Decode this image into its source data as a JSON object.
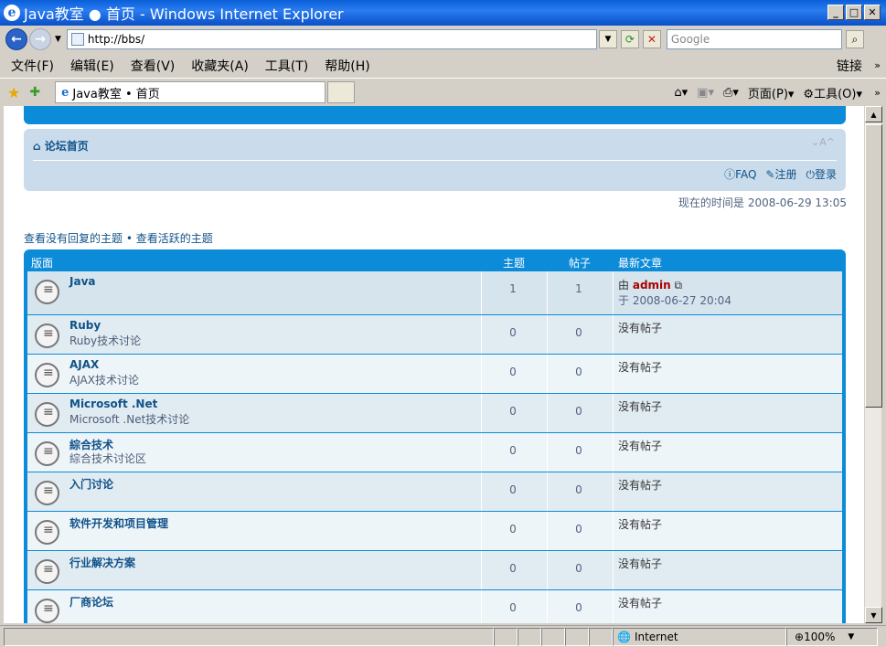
{
  "window": {
    "title": "Java教室 ● 首页 - Windows Internet Explorer"
  },
  "address": {
    "url": "http://bbs/",
    "search_placeholder": "Google"
  },
  "menu": [
    "文件(F)",
    "编辑(E)",
    "查看(V)",
    "收藏夹(A)",
    "工具(T)",
    "帮助(H)"
  ],
  "menu_links": "链接",
  "tab": {
    "label": "Java教室 • 首页"
  },
  "cmd": {
    "page": "页面(P)",
    "tools": "工具(O)"
  },
  "nav": {
    "home": "论坛首页",
    "font_size": "⌄A^",
    "faq": "FAQ",
    "register": "注册",
    "login": "登录"
  },
  "current_time": {
    "label": "现在的时间是",
    "value": "2008-06-29 13:05"
  },
  "actions": {
    "unanswered": "查看没有回复的主题",
    "active": "查看活跃的主题"
  },
  "table": {
    "headers": {
      "forum": "版面",
      "topics": "主题",
      "posts": "帖子",
      "last_post": "最新文章"
    },
    "rows": [
      {
        "name": "Java",
        "desc": "",
        "topics": "1",
        "posts": "1",
        "last_by": "由",
        "last_user": "admin",
        "last_at": "于 2008-06-27 20:04"
      },
      {
        "name": "Ruby",
        "desc": "Ruby技术讨论",
        "topics": "0",
        "posts": "0",
        "last": "没有帖子"
      },
      {
        "name": "AJAX",
        "desc": "AJAX技术讨论",
        "topics": "0",
        "posts": "0",
        "last": "没有帖子"
      },
      {
        "name": "Microsoft .Net",
        "desc": "Microsoft .Net技术讨论",
        "topics": "0",
        "posts": "0",
        "last": "没有帖子"
      },
      {
        "name": "綜合技术",
        "desc": "綜合技术讨论区",
        "topics": "0",
        "posts": "0",
        "last": "没有帖子"
      },
      {
        "name": "入门讨论",
        "desc": "",
        "topics": "0",
        "posts": "0",
        "last": "没有帖子"
      },
      {
        "name": "软件开发和项目管理",
        "desc": "",
        "topics": "0",
        "posts": "0",
        "last": "没有帖子"
      },
      {
        "name": "行业解决方案",
        "desc": "",
        "topics": "0",
        "posts": "0",
        "last": "没有帖子"
      },
      {
        "name": "厂商论坛",
        "desc": "",
        "topics": "0",
        "posts": "0",
        "last": "没有帖子"
      }
    ]
  },
  "status": {
    "zone": "Internet",
    "zoom": "100%"
  }
}
